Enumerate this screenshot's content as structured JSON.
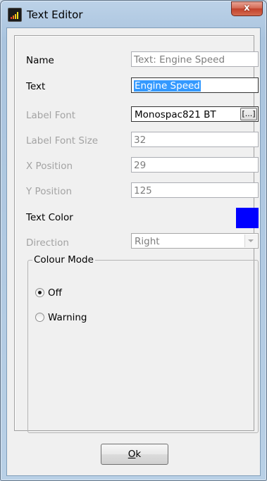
{
  "window": {
    "title": "Text Editor",
    "close_glyph": "x"
  },
  "form": {
    "name": {
      "label": "Name",
      "value": "Text: Engine Speed"
    },
    "text": {
      "label": "Text",
      "value": "Engine Speed"
    },
    "label_font": {
      "label": "Label Font",
      "value": "Monospac821 BT",
      "browse_label": "[...]"
    },
    "label_font_size": {
      "label": "Label Font Size",
      "value": "32"
    },
    "x_position": {
      "label": "X Position",
      "value": "29"
    },
    "y_position": {
      "label": "Y Position",
      "value": "125"
    },
    "text_color": {
      "label": "Text Color",
      "color": "#0000ff"
    },
    "direction": {
      "label": "Direction",
      "value": "Right"
    }
  },
  "colour_mode": {
    "title": "Colour Mode",
    "options": [
      {
        "label": "Off",
        "checked": true
      },
      {
        "label": "Warning",
        "checked": false
      }
    ]
  },
  "buttons": {
    "ok_mnemonic": "O",
    "ok_rest": "k"
  }
}
